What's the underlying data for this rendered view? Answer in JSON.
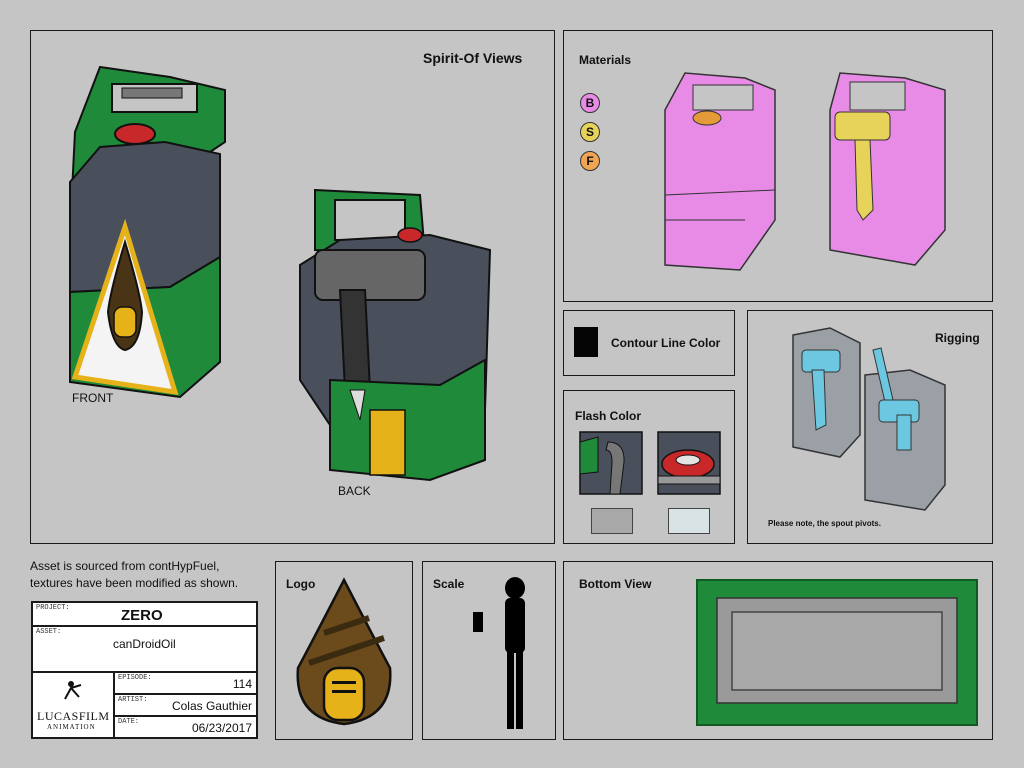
{
  "spirit_views": {
    "title": "Spirit-Of Views",
    "front_label": "FRONT",
    "back_label": "BACK"
  },
  "materials": {
    "title": "Materials",
    "badges": [
      "B",
      "S",
      "F"
    ]
  },
  "contour": {
    "title": "Contour Line Color"
  },
  "flash": {
    "title": "Flash Color"
  },
  "rigging": {
    "title": "Rigging",
    "note": "Please note, the spout pivots."
  },
  "asset_note": {
    "line1": "Asset is sourced from contHypFuel,",
    "line2": "textures have been modified as shown."
  },
  "title_block": {
    "project_key": "PROJECT:",
    "project": "ZERO",
    "asset_key": "ASSET:",
    "asset": "canDroidOil",
    "episode_key": "EPISODE:",
    "episode": "114",
    "artist_key": "ARTIST:",
    "artist": "Colas Gauthier",
    "date_key": "DATE:",
    "date": "06/23/2017",
    "logo_text1": "LUCASFILM",
    "logo_text2": "ANIMATION"
  },
  "logo_panel": {
    "title": "Logo"
  },
  "scale_panel": {
    "title": "Scale"
  },
  "bottom_view": {
    "title": "Bottom View"
  },
  "colors": {
    "green": "#1f8a3a",
    "body": "#4a4f5c",
    "magenta": "#e78be6",
    "yellow": "#e7d35a",
    "cyan": "#6cc8e0",
    "gold": "#e6b21a",
    "red": "#c8282a"
  }
}
